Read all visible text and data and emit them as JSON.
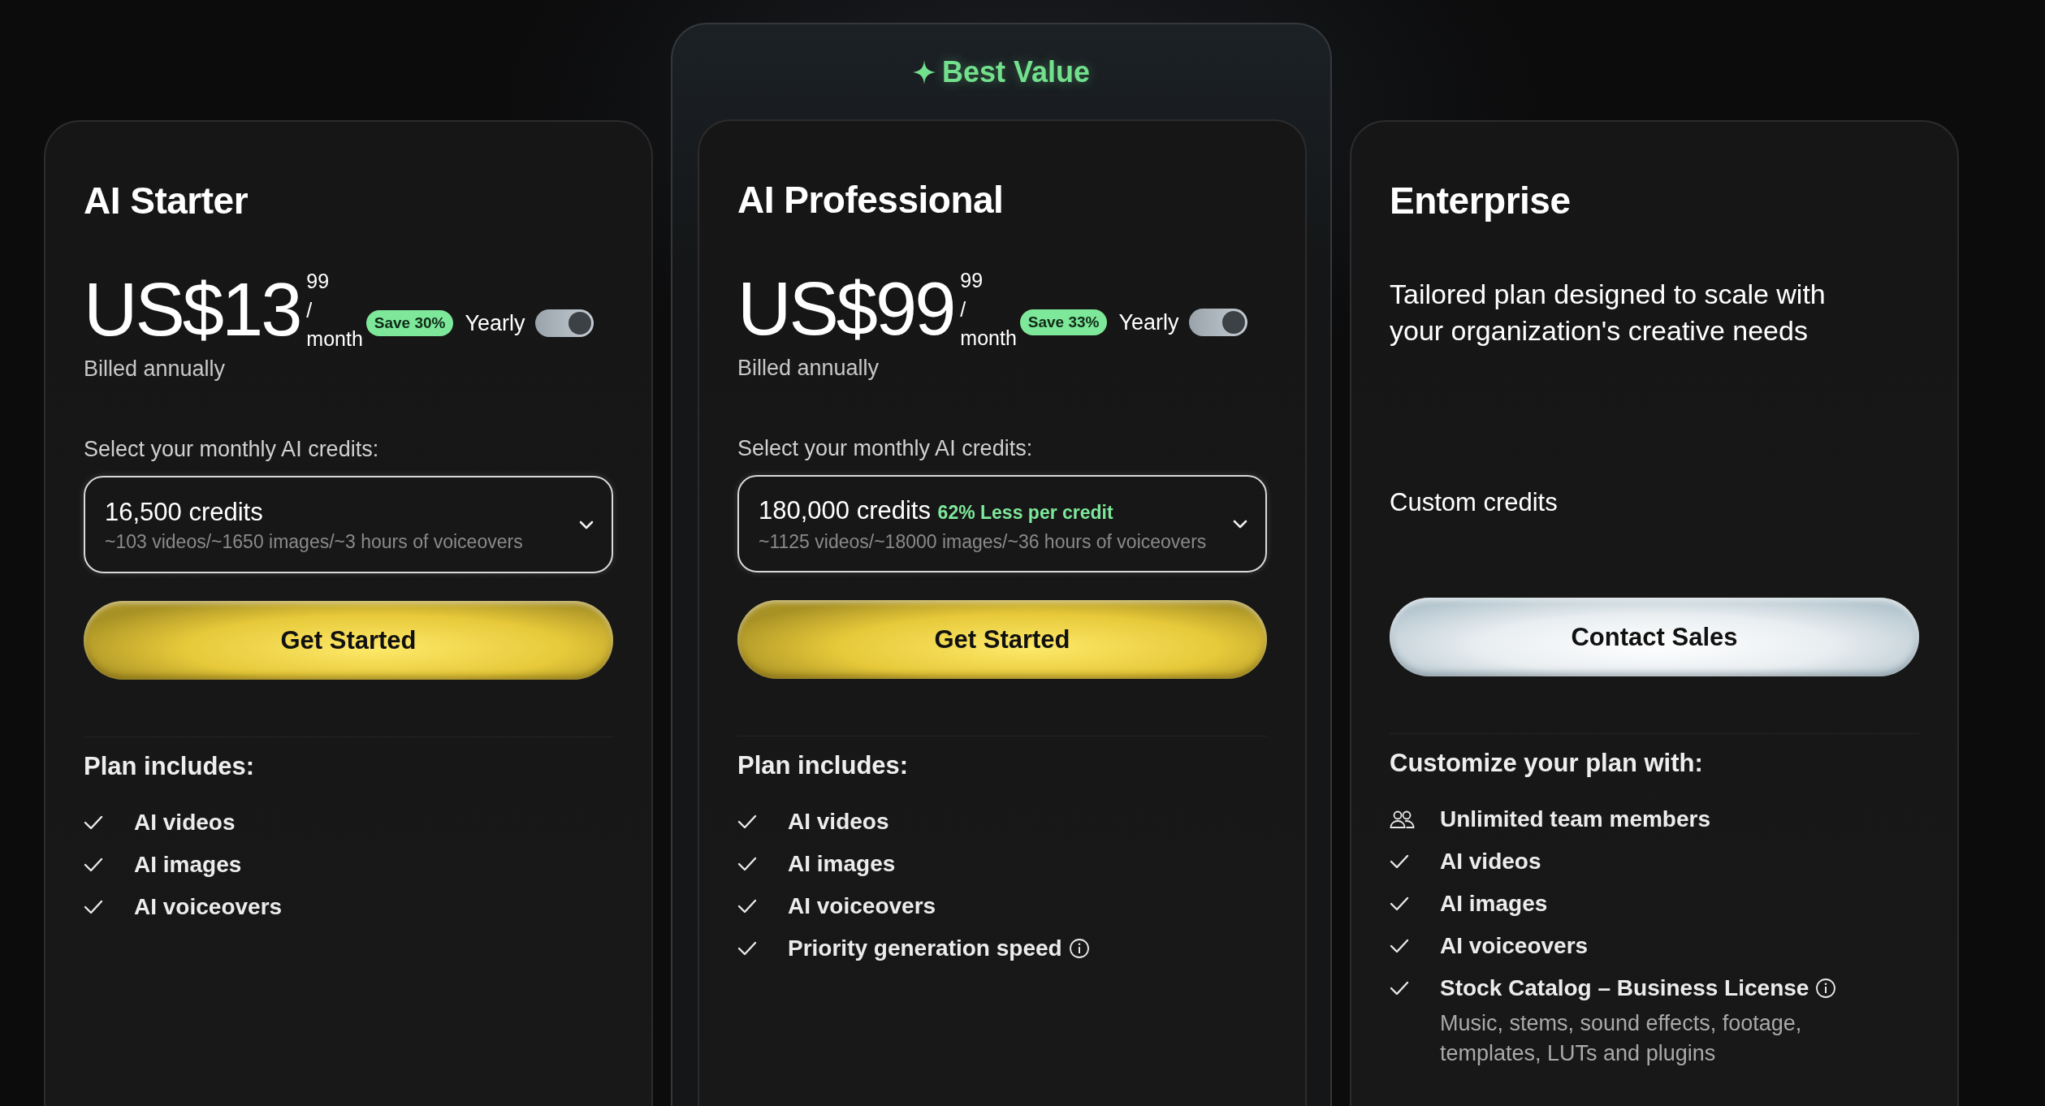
{
  "plans": [
    {
      "name": "AI Starter",
      "price": {
        "amount": "US$13",
        "cents": "99",
        "per": "/",
        "period": "month"
      },
      "save_badge": "Save 30%",
      "toggle": {
        "label": "Yearly",
        "on": true
      },
      "billing_note": "Billed annually",
      "credits_label": "Select your monthly AI credits:",
      "credits_select": {
        "value": "16,500 credits",
        "details": "~103 videos/~1650 images/~3 hours of voiceovers"
      },
      "button": {
        "label": "Get Started",
        "kind": "gold"
      },
      "features_heading": "Plan includes:",
      "features": [
        {
          "kind": "check",
          "label": "AI videos",
          "info": false
        },
        {
          "kind": "check",
          "label": "AI images",
          "info": false
        },
        {
          "kind": "check",
          "label": "AI voiceovers",
          "info": false
        }
      ]
    },
    {
      "badge": "Best Value",
      "name": "AI Professional",
      "price": {
        "amount": "US$99",
        "cents": "99",
        "per": "/",
        "period": "month"
      },
      "save_badge": "Save 33%",
      "toggle": {
        "label": "Yearly",
        "on": true
      },
      "billing_note": "Billed annually",
      "credits_label": "Select your monthly AI credits:",
      "credits_select": {
        "value": "180,000 credits",
        "discount": "62% Less per credit",
        "details": "~1125 videos/~18000 images/~36 hours of voiceovers"
      },
      "button": {
        "label": "Get Started",
        "kind": "gold"
      },
      "features_heading": "Plan includes:",
      "features": [
        {
          "kind": "check",
          "label": "AI videos",
          "info": false
        },
        {
          "kind": "check",
          "label": "AI images",
          "info": false
        },
        {
          "kind": "check",
          "label": "AI voiceovers",
          "info": false
        },
        {
          "kind": "check",
          "label": "Priority generation speed",
          "info": true
        }
      ]
    },
    {
      "name": "Enterprise",
      "description": "Tailored plan designed to scale with your organization's creative needs",
      "credits_note": "Custom credits",
      "button": {
        "label": "Contact Sales",
        "kind": "silver"
      },
      "features_heading": "Customize your plan with:",
      "features": [
        {
          "kind": "team",
          "label": "Unlimited team members",
          "info": false
        },
        {
          "kind": "check",
          "label": "AI videos",
          "info": false
        },
        {
          "kind": "check",
          "label": "AI images",
          "info": false
        },
        {
          "kind": "check",
          "label": "AI voiceovers",
          "info": false
        },
        {
          "kind": "check",
          "label": "Stock Catalog – Business License",
          "info": true,
          "note": "Music, stems, sound effects, footage, templates, LUTs and plugins"
        }
      ]
    }
  ]
}
